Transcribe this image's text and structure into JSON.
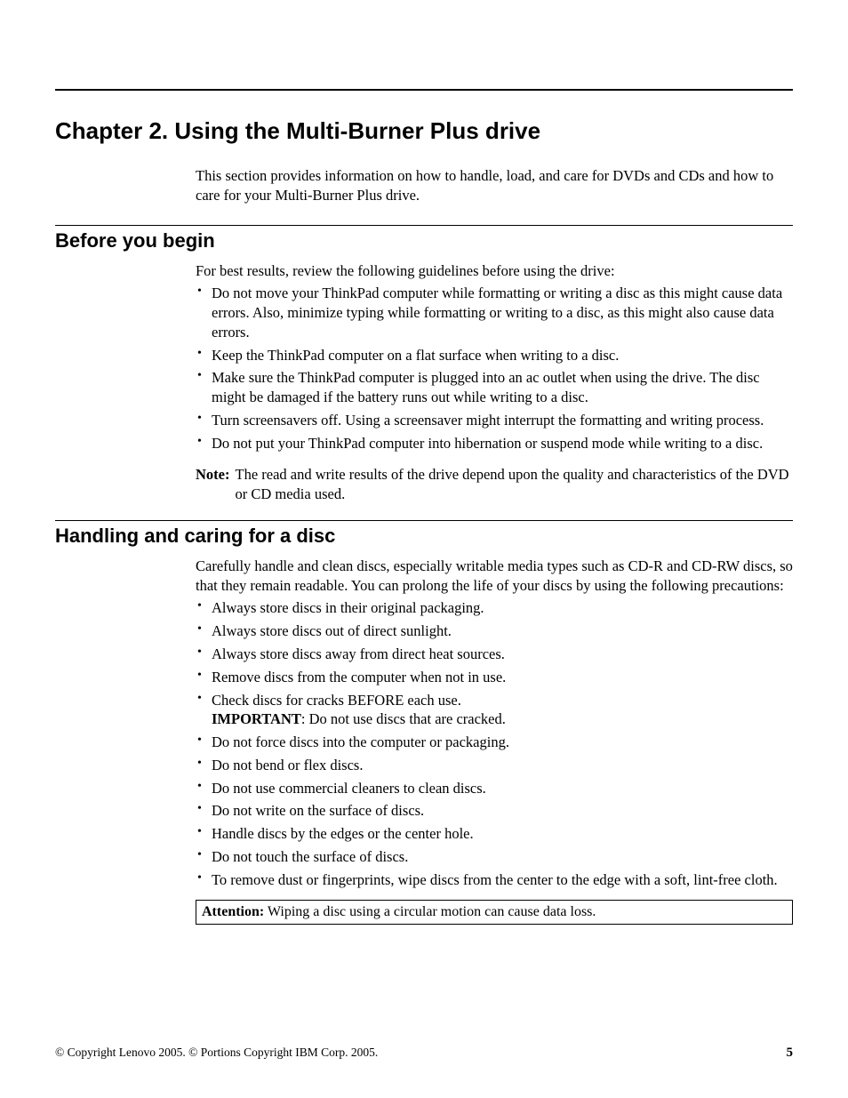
{
  "chapter": {
    "title": "Chapter 2. Using the Multi-Burner Plus drive",
    "intro": "This section provides information on how to handle, load, and care for DVDs and CDs and how to care for your Multi-Burner Plus drive."
  },
  "section1": {
    "title": "Before you begin",
    "lead": "For best results, review the following guidelines before using the drive:",
    "bullets": [
      "Do not move your ThinkPad computer while formatting or writing a disc as this might cause data errors. Also, minimize typing while formatting or writing to a disc, as this might also cause data errors.",
      "Keep the ThinkPad computer on a flat surface when writing to a disc.",
      "Make sure the ThinkPad computer is plugged into an ac outlet when using the drive. The disc might be damaged if the battery runs out while writing to a disc.",
      "Turn screensavers off. Using a screensaver might interrupt the formatting and writing process.",
      "Do not put your ThinkPad computer into hibernation or suspend mode while writing to a disc."
    ],
    "note_label": "Note:",
    "note_text": "The read and write results of the drive depend upon the quality and characteristics of the DVD or CD media used."
  },
  "section2": {
    "title": "Handling and caring for a disc",
    "lead": "Carefully handle and clean discs, especially writable media types such as CD-R and CD-RW discs, so that they remain readable. You can prolong the life of your discs by using the following precautions:",
    "bullets_a": [
      "Always store discs in their original packaging.",
      "Always store discs out of direct sunlight.",
      "Always store discs away from direct heat sources.",
      "Remove discs from the computer when not in use."
    ],
    "bullet_check": "Check discs for cracks BEFORE each use.",
    "important_label": "IMPORTANT",
    "important_text": ": Do not use discs that are cracked.",
    "bullets_b": [
      "Do not force discs into the computer or packaging.",
      "Do not bend or flex discs.",
      "Do not use commercial cleaners to clean discs.",
      "Do not write on the surface of discs.",
      "Handle discs by the edges or the center hole.",
      "Do not touch the surface of discs.",
      "To remove dust or fingerprints, wipe discs from the center to the edge with a soft, lint-free cloth."
    ],
    "attention_label": "Attention:",
    "attention_text": " Wiping a disc using a circular motion can cause data loss."
  },
  "footer": {
    "copyright": "© Copyright Lenovo 2005. © Portions Copyright IBM Corp. 2005.",
    "page": "5"
  }
}
